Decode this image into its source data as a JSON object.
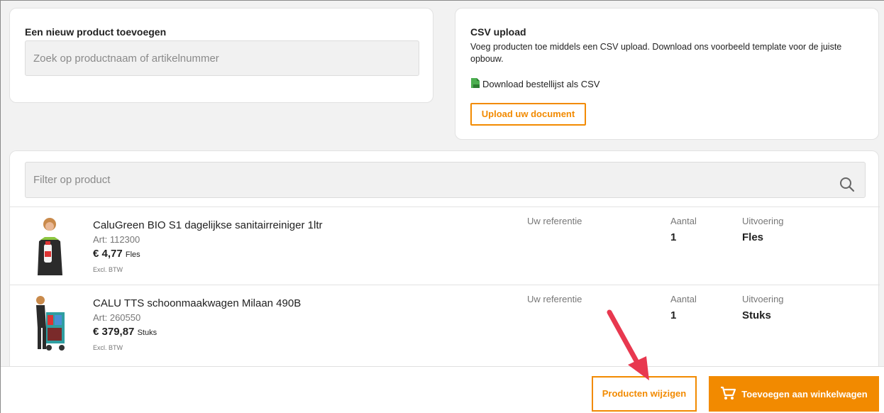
{
  "add_product": {
    "title": "Een nieuw product toevoegen",
    "search_placeholder": "Zoek op productnaam of artikelnummer"
  },
  "csv": {
    "title": "CSV upload",
    "description": "Voeg producten toe middels een CSV upload. Download ons voorbeeld template voor de juiste opbouw.",
    "download_label": "Download bestellijst als CSV",
    "upload_label": "Upload uw document"
  },
  "list": {
    "filter_placeholder": "Filter op product",
    "columns": {
      "reference": "Uw referentie",
      "quantity": "Aantal",
      "variant": "Uitvoering"
    },
    "products": [
      {
        "name": "CaluGreen BIO S1 dagelijkse sanitairreiniger 1ltr",
        "art": "Art: 112300",
        "price": "€ 4,77",
        "price_unit": "Fles",
        "vat": "Excl. BTW",
        "quantity": "1",
        "variant": "Fles"
      },
      {
        "name": "CALU TTS schoonmaakwagen Milaan 490B",
        "art": "Art: 260550",
        "price": "€ 379,87",
        "price_unit": "Stuks",
        "vat": "Excl. BTW",
        "quantity": "1",
        "variant": "Stuks"
      }
    ]
  },
  "actions": {
    "change_products": "Producten wijzigen",
    "add_to_cart": "Toevoegen aan winkelwagen"
  },
  "colors": {
    "accent": "#f28a00",
    "annotation_arrow": "#e8384f"
  },
  "icons": [
    "csv-file-icon",
    "search-icon",
    "cart-icon"
  ]
}
